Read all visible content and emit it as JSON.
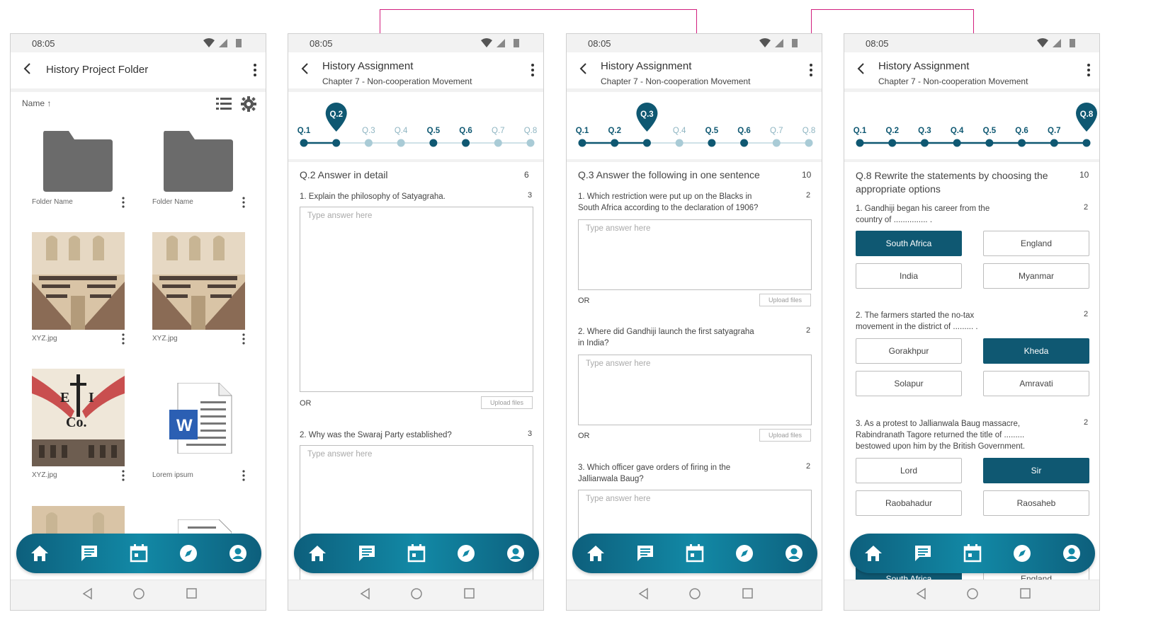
{
  "status_time": "08:05",
  "folder_screen": {
    "title": "History Project Folder",
    "sort_label": "Name",
    "items": [
      {
        "label": "Folder Name",
        "type": "folder"
      },
      {
        "label": "Folder Name",
        "type": "folder"
      },
      {
        "label": "XYZ.jpg",
        "type": "image"
      },
      {
        "label": "XYZ.jpg",
        "type": "image"
      },
      {
        "label": "XYZ.jpg",
        "type": "image"
      },
      {
        "label": "Lorem ipsum",
        "type": "document"
      }
    ],
    "doc_letter": "W",
    "eic_letters": {
      "e": "E",
      "i": "I",
      "co": "Co."
    }
  },
  "assignment": {
    "title": "History Assignment",
    "subtitle": "Chapter 7 - Non-cooperation Movement",
    "questions": [
      "Q.1",
      "Q.2",
      "Q.3",
      "Q.4",
      "Q.5",
      "Q.6",
      "Q.7",
      "Q.8"
    ]
  },
  "screen2": {
    "active": "Q.2",
    "q_heading": "Q.2  Answer in detail",
    "q_marks": "6",
    "items": [
      {
        "text": "1. Explain the philosophy of Satyagraha.",
        "marks": "3"
      },
      {
        "text": "2. Why was the Swaraj Party established?",
        "marks": "3"
      }
    ],
    "placeholder": "Type answer here",
    "or": "OR",
    "upload": "Upload files"
  },
  "screen3": {
    "active": "Q.3",
    "q_heading": "Q.3  Answer the following in one sentence",
    "q_marks": "10",
    "items": [
      {
        "line1": "1. Which restriction were put up on the Blacks in",
        "line2": "South Africa according to the declaration of 1906?",
        "marks": "2"
      },
      {
        "line1": "2. Where did Gandhiji launch the first satyagraha",
        "line2": "in India?",
        "marks": "2"
      },
      {
        "line1": "3. Which officer gave orders of firing in the",
        "line2": "Jallianwala Baug?",
        "marks": "2"
      }
    ],
    "placeholder": "Type answer here",
    "or": "OR",
    "upload": "Upload files"
  },
  "screen4": {
    "active": "Q.8",
    "q_heading_line1": "Q.8  Rewrite the statements by choosing the",
    "q_heading_line2": "appropriate options",
    "q_marks": "10",
    "items": [
      {
        "line1": "1. Gandhiji began his career from the",
        "line2": "country of ............... .",
        "line3": "",
        "marks": "2",
        "options": [
          "South Africa",
          "England",
          "India",
          "Myanmar"
        ],
        "selected": 0
      },
      {
        "line1": "2. The farmers started the no-tax",
        "line2": "movement in the district of ......... .",
        "line3": "",
        "marks": "2",
        "options": [
          "Gorakhpur",
          "Kheda",
          "Solapur",
          "Amravati"
        ],
        "selected": 1
      },
      {
        "line1": "3. As a protest to Jallianwala Baug massacre,",
        "line2": "Rabindranath Tagore returned the title of .........",
        "line3": "bestowed upon him by the British Government.",
        "marks": "2",
        "options": [
          "Lord",
          "Sir",
          "Raobahadur",
          "Raosaheb"
        ],
        "selected": 1
      }
    ]
  },
  "tabbar": {
    "icons": [
      "home-icon",
      "chat-icon",
      "calendar-icon",
      "compass-icon",
      "profile-icon"
    ]
  },
  "colors": {
    "primary": "#0f5872",
    "tabbar": "#1289a6",
    "accent_line": "#d21f7e"
  }
}
